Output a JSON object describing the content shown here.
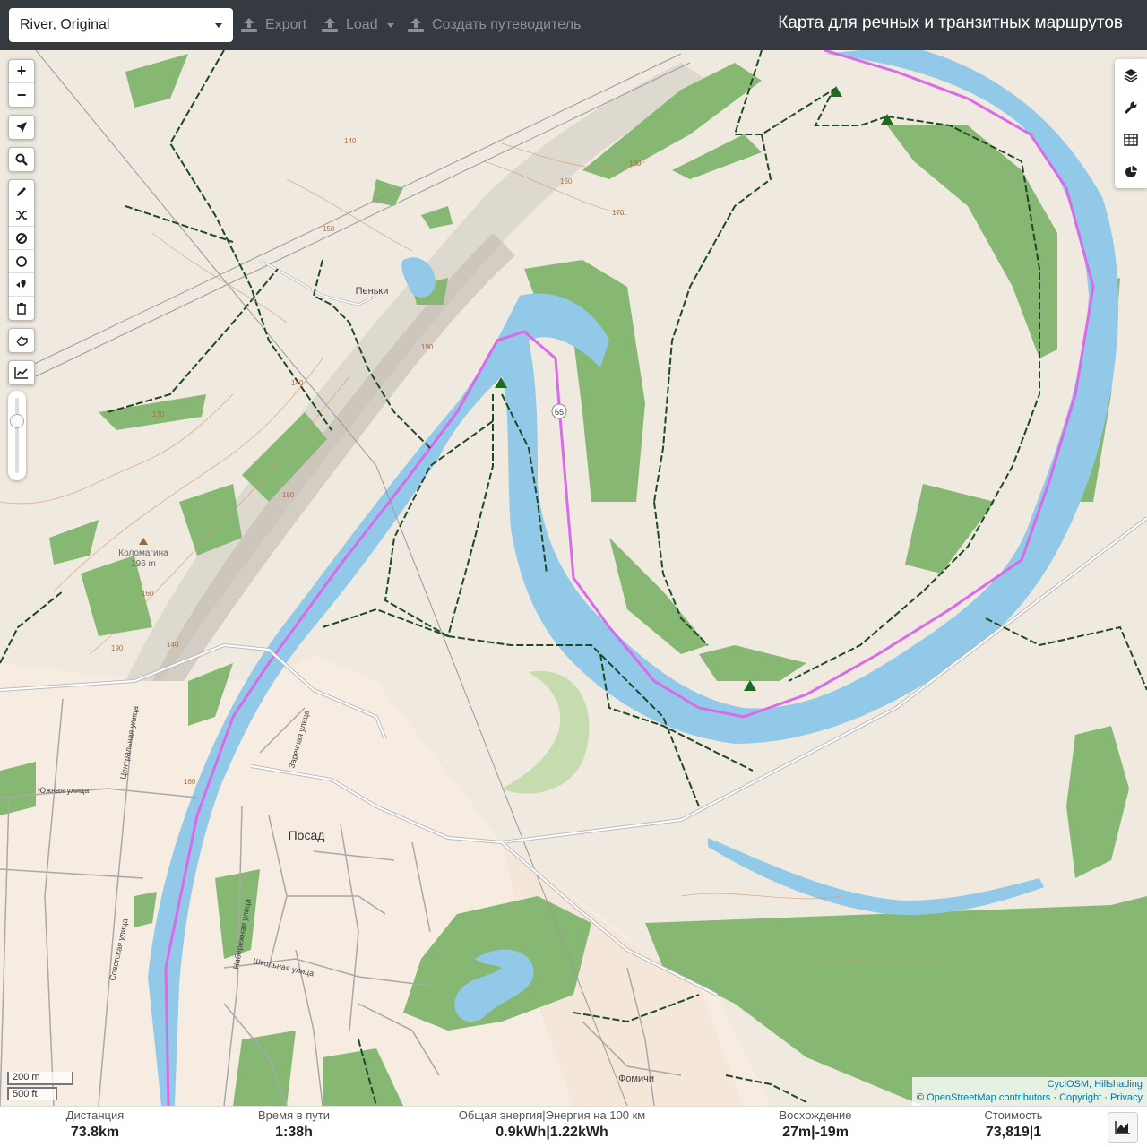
{
  "header": {
    "profile": "River, Original",
    "export": "Export",
    "load": "Load",
    "guide": "Создать путеводитель",
    "title": "Карта для речных и транзитных маршрутов"
  },
  "map": {
    "places": {
      "penki": "Пеньки",
      "kolomagina": "Коломагина",
      "kolomagina_elev": "196 m",
      "posad": "Посад",
      "fomichi": "Фомичи"
    },
    "streets": {
      "tsentralnaya": "Центральная улица",
      "yuzhnaya": "Южная улица",
      "zarechnaya": "Заречная улица",
      "sovetskaya": "Советская улица",
      "naberezhnaya": "Набережная улица",
      "shkolnaya": "Школьная улица"
    },
    "route_shield": "65",
    "contours": [
      "150",
      "140",
      "160",
      "170",
      "180",
      "190",
      "140",
      "170",
      "180",
      "160",
      "140",
      "190",
      "160"
    ],
    "scale_metric": "200 m",
    "scale_imperial": "500 ft",
    "attribution": {
      "layer": "CyclOSM",
      "layer2": "Hillshading",
      "osm": "OpenStreetMap contributors",
      "copyright": "Copyright",
      "privacy": "Privacy"
    },
    "icons": {
      "zoom_in": "plus-icon",
      "zoom_out": "minus-icon",
      "locate": "location-arrow-icon",
      "search": "search-icon",
      "draw": "pencil-icon",
      "shuffle": "shuffle-icon",
      "nogo": "ban-icon",
      "circle": "circle-icon",
      "poi": "marker-icon",
      "delete": "trash-icon",
      "hand": "hand-icon",
      "chart": "line-chart-icon",
      "layers": "layers-icon",
      "settings": "wrench-icon",
      "table": "table-icon",
      "pie": "pie-chart-icon"
    }
  },
  "stats": {
    "distance_label": "Дистанция",
    "distance_value": "73.8",
    "distance_unit": "km",
    "time_label": "Время в пути",
    "time_value": "1:38",
    "time_unit": "h",
    "energy_label": "Общая энергия",
    "energy100_label": "Энергия на 100 км",
    "energy_value": "0.9",
    "energy_unit": "kWh",
    "energy100_value": "1.22",
    "energy100_unit": "kWh",
    "ascent_label": "Восхождение",
    "ascent_value": "27",
    "ascent_unit": "m",
    "descent_value": "-19",
    "descent_unit": "m",
    "cost_label": "Стоимость",
    "cost_value": "73,819",
    "cost_count": "1"
  },
  "colors": {
    "water": "#92c9e9",
    "route": "#d96ae8",
    "forest": "#86b874",
    "land": "#efe9df",
    "settlement": "#f7ece2",
    "track": "#1e4a23",
    "header": "#343a40"
  }
}
